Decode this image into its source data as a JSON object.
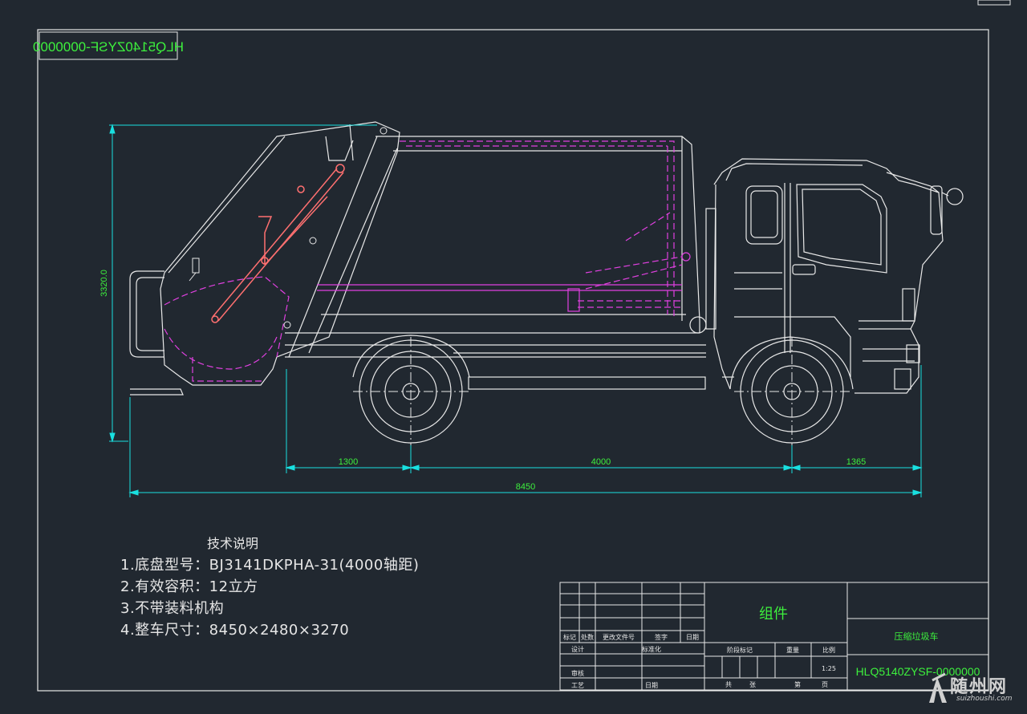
{
  "frame_code": "HLQ5140ZYSF-0000000",
  "dimensions": {
    "height": "3320.0",
    "rear_overhang": "1300",
    "wheelbase": "4000",
    "front_overhang": "1365",
    "overall_length": "8450"
  },
  "notes": {
    "heading": "技术说明",
    "items": [
      "1.底盘型号：BJ3141DKPHA-31(4000轴距)",
      "2.有效容积：12立方",
      "3.不带装料机构",
      "4.整车尺寸：8450×2480×3270"
    ]
  },
  "title_block": {
    "assembly": "组件",
    "product_name": "压缩垃圾车",
    "drawing_number": "HLQ5140ZYSF-0000000",
    "scale": "1:25",
    "rev_headers": [
      "标记",
      "处数",
      "更改文件号",
      "签字",
      "日期"
    ],
    "design": "设计",
    "standardization": "标准化",
    "review": "审核",
    "process": "工艺",
    "date": "日期",
    "stage_mark": "阶段标记",
    "weight": "重量",
    "ratio": "比例",
    "total": "共",
    "sheet": "张",
    "page_of": "第",
    "page": "页"
  },
  "watermark": {
    "name": "随州网",
    "url": "suizhoushi.com"
  },
  "colors": {
    "background": "#212830",
    "line": "#e8e8e8",
    "dimension": "#19e0e0",
    "hidden": "#e040e0",
    "cylinder": "#ff7070",
    "text_green": "#3df03d"
  }
}
